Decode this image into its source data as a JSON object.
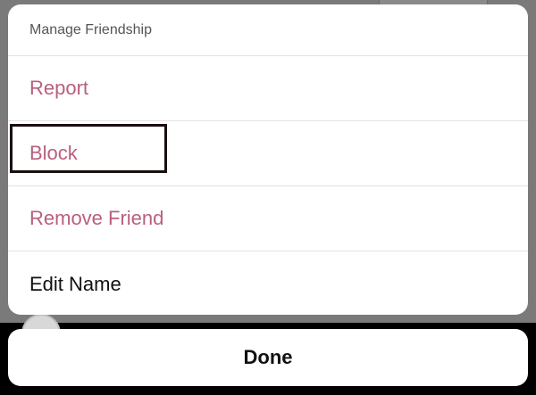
{
  "sheet": {
    "title": "Manage Friendship",
    "items": [
      {
        "label": "Report",
        "style": "destructive"
      },
      {
        "label": "Block",
        "style": "destructive",
        "highlighted": true
      },
      {
        "label": "Remove Friend",
        "style": "destructive"
      },
      {
        "label": "Edit Name",
        "style": "normal"
      }
    ]
  },
  "done": {
    "label": "Done"
  },
  "colors": {
    "destructive": "#b95f7d",
    "normal": "#111111",
    "divider": "#e2e2e2"
  }
}
